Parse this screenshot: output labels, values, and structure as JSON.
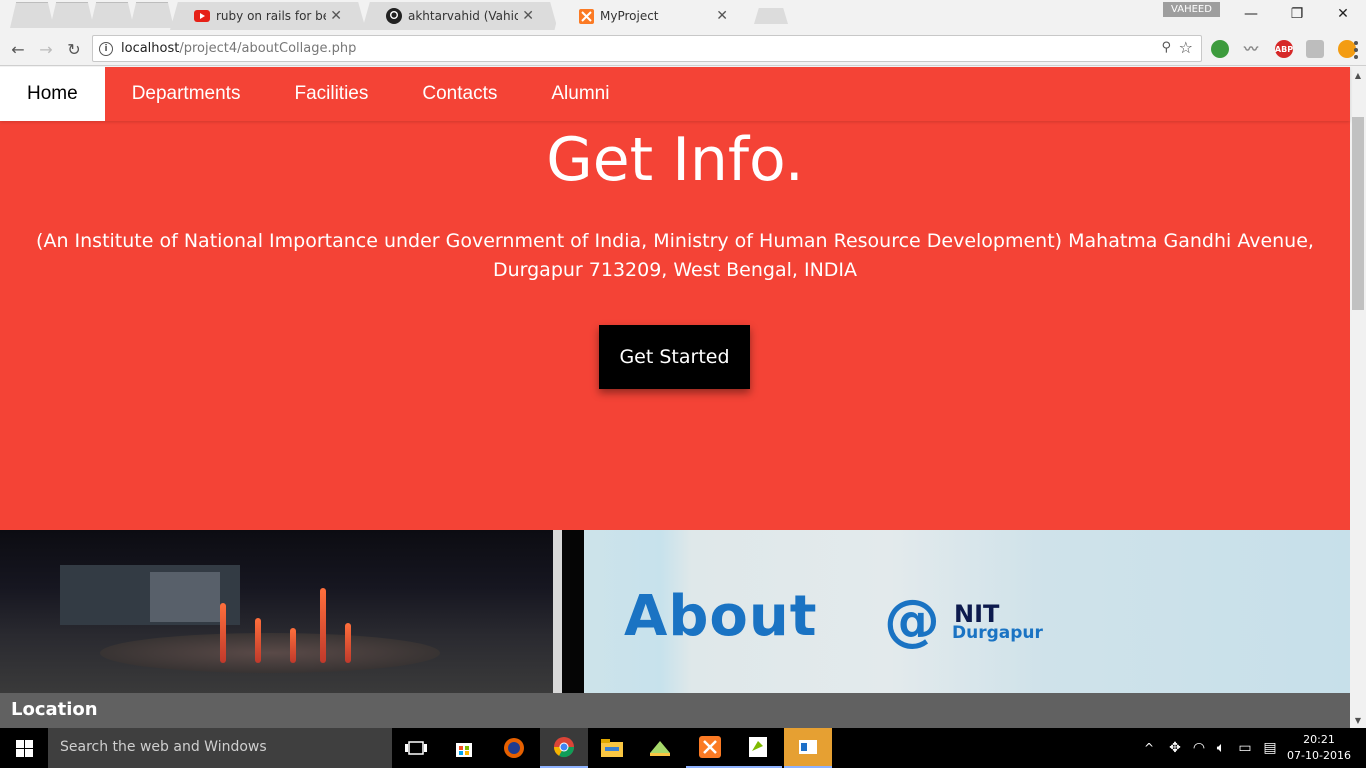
{
  "browser": {
    "tabs": [
      {
        "title": "ruby on rails for beginne",
        "icon": "youtube-icon",
        "active": false
      },
      {
        "title": "akhtarvahid (Vahid Akhta",
        "icon": "github-icon",
        "active": false
      },
      {
        "title": "MyProject",
        "icon": "xampp-icon",
        "active": true
      }
    ],
    "profile_name": "VAHEED",
    "address": {
      "host": "localhost",
      "path": "/project4/aboutCollage.php"
    },
    "extensions": [
      "extension-icon",
      "extension-icon",
      "adblock-icon",
      "extension-icon",
      "extension-icon"
    ],
    "adblock_label": "ABP"
  },
  "page": {
    "nav": [
      {
        "label": "Home",
        "active": true
      },
      {
        "label": "Departments",
        "active": false
      },
      {
        "label": "Facilities",
        "active": false
      },
      {
        "label": "Contacts",
        "active": false
      },
      {
        "label": "Alumni",
        "active": false
      }
    ],
    "hero": {
      "title": "Get Info.",
      "description": "(An Institute of National Importance under Government of India, Ministry of Human Resource Development) Mahatma Gandhi Avenue, Durgapur 713209, West Bengal, INDIA",
      "button_label": "Get Started"
    },
    "banner": {
      "about_text": "About",
      "at_text": "@",
      "nit_text": "NIT",
      "durgapur_text": "Durgapur"
    },
    "section_label": "Location",
    "colors": {
      "accent": "#f44336",
      "button": "#000000",
      "location_bar": "#616161"
    }
  },
  "taskbar": {
    "search_placeholder": "Search the web and Windows",
    "apps": [
      "task-view-icon",
      "store-icon",
      "firefox-icon",
      "chrome-icon",
      "file-explorer-icon",
      "photos-icon",
      "xampp-icon",
      "notepadpp-icon",
      "window-icon"
    ],
    "time": "20:21",
    "date": "07-10-2016"
  }
}
